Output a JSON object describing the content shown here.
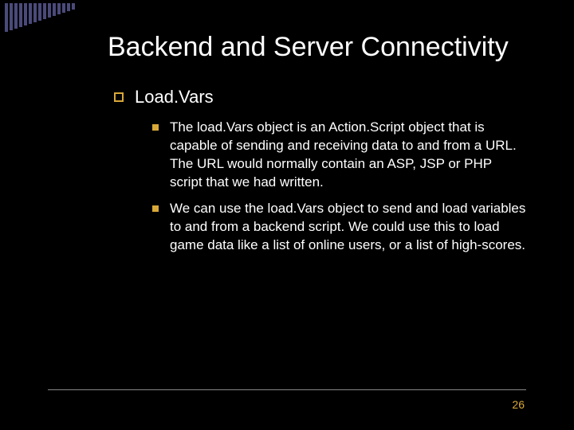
{
  "title": "Backend and Server Connectivity",
  "level1": {
    "heading": "Load.Vars"
  },
  "bullets": [
    "The load.Vars object is an Action.Script object that is capable of sending and receiving data to and from a URL. The URL would normally contain an ASP, JSP or PHP script that we had written.",
    "We can use the load.Vars object to send and load variables to and from a backend script. We could use this to load game data like a list of online users, or a list of high-scores."
  ],
  "pageNumber": "26",
  "colors": {
    "accent": "#d8a838",
    "stripe": "#4a4a7a"
  }
}
